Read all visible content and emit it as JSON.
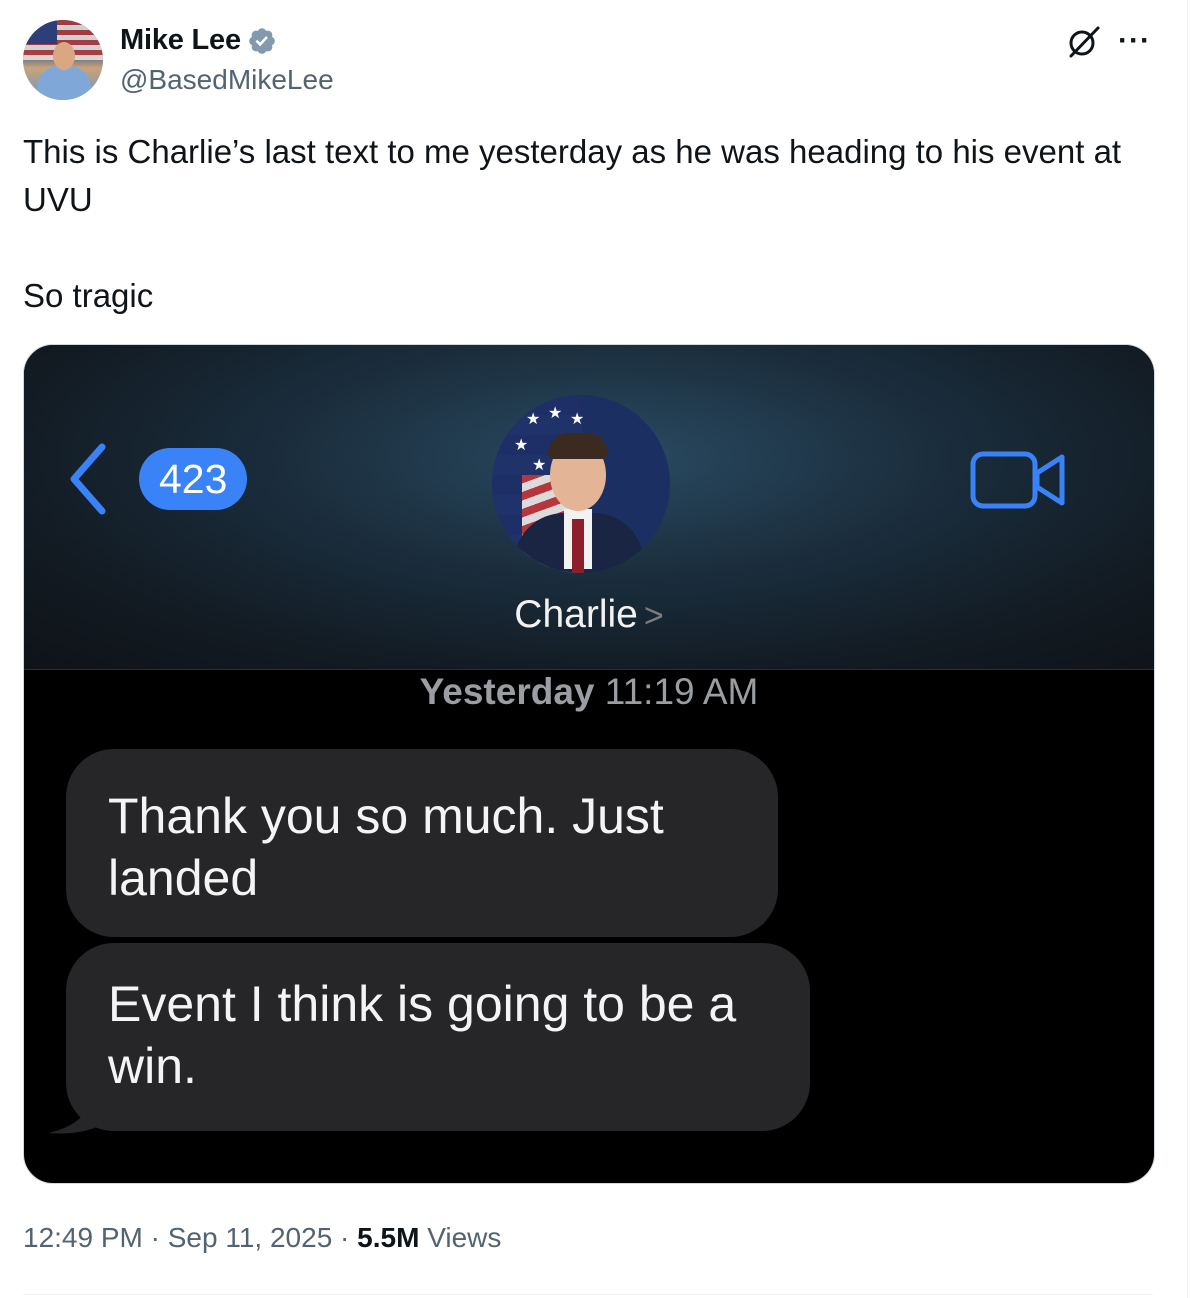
{
  "author": {
    "display_name": "Mike Lee",
    "handle": "@BasedMikeLee",
    "verified": true,
    "verified_color": "#829aab"
  },
  "tweet": {
    "text": "This is Charlie’s last text to me yesterday as he was heading to his event at UVU\n\nSo tragic"
  },
  "screenshot": {
    "back_count": "423",
    "contact_name": "Charlie",
    "timestamp_day": "Yesterday",
    "timestamp_time": "11:19 AM",
    "messages": [
      "Thank you so much. Just landed",
      "Event I think is going to be a win."
    ],
    "accent_color": "#3a82f7"
  },
  "meta": {
    "time": "12:49 PM",
    "date": "Sep 11, 2025",
    "views_count": "5.5M",
    "views_label": "Views"
  },
  "icons": [
    "verified-badge-icon",
    "grok-icon",
    "more-icon",
    "back-chevron-icon",
    "video-call-icon"
  ]
}
